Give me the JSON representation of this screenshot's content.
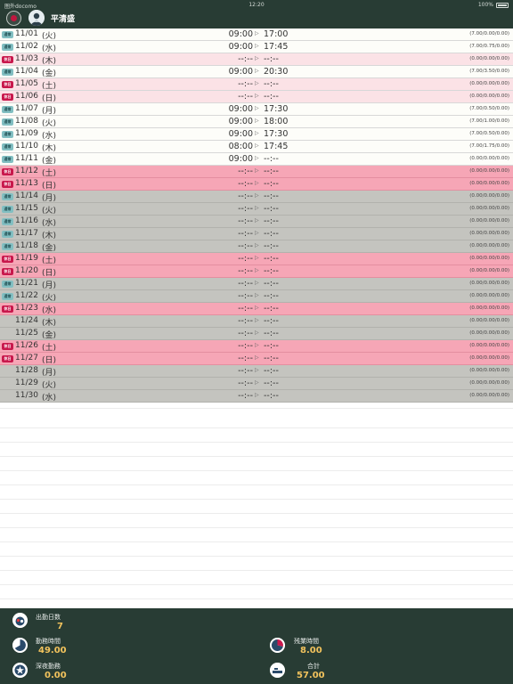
{
  "status_bar": {
    "carrier": "圏外docomo",
    "time": "12:20",
    "battery": "100%"
  },
  "header": {
    "user_name": "平清盛"
  },
  "days": [
    {
      "badge": "通常",
      "date": "11/01",
      "dow": "(火)",
      "in": "09:00",
      "out": "17:00",
      "hours": "(7.00/0.00/0.00)",
      "bg": "white"
    },
    {
      "badge": "通常",
      "date": "11/02",
      "dow": "(水)",
      "in": "09:00",
      "out": "17:45",
      "hours": "(7.00/0.75/0.00)",
      "bg": "white"
    },
    {
      "badge": "休日",
      "date": "11/03",
      "dow": "(木)",
      "in": "--:--",
      "out": "--:--",
      "hours": "(0.00/0.00/0.00)",
      "bg": "pink"
    },
    {
      "badge": "通常",
      "date": "11/04",
      "dow": "(金)",
      "in": "09:00",
      "out": "20:30",
      "hours": "(7.00/3.50/0.00)",
      "bg": "white"
    },
    {
      "badge": "休日",
      "date": "11/05",
      "dow": "(土)",
      "in": "--:--",
      "out": "--:--",
      "hours": "(0.00/0.00/0.00)",
      "bg": "pink"
    },
    {
      "badge": "休日",
      "date": "11/06",
      "dow": "(日)",
      "in": "--:--",
      "out": "--:--",
      "hours": "(0.00/0.00/0.00)",
      "bg": "pink"
    },
    {
      "badge": "通常",
      "date": "11/07",
      "dow": "(月)",
      "in": "09:00",
      "out": "17:30",
      "hours": "(7.00/0.50/0.00)",
      "bg": "white"
    },
    {
      "badge": "通常",
      "date": "11/08",
      "dow": "(火)",
      "in": "09:00",
      "out": "18:00",
      "hours": "(7.00/1.00/0.00)",
      "bg": "white"
    },
    {
      "badge": "通常",
      "date": "11/09",
      "dow": "(水)",
      "in": "09:00",
      "out": "17:30",
      "hours": "(7.00/0.50/0.00)",
      "bg": "white"
    },
    {
      "badge": "通常",
      "date": "11/10",
      "dow": "(木)",
      "in": "08:00",
      "out": "17:45",
      "hours": "(7.00/1.75/0.00)",
      "bg": "white"
    },
    {
      "badge": "通常",
      "date": "11/11",
      "dow": "(金)",
      "in": "09:00",
      "out": "--:--",
      "hours": "(0.00/0.00/0.00)",
      "bg": "white"
    },
    {
      "badge": "休日",
      "date": "11/12",
      "dow": "(土)",
      "in": "--:--",
      "out": "--:--",
      "hours": "(0.00/0.00/0.00)",
      "bg": "rose"
    },
    {
      "badge": "休日",
      "date": "11/13",
      "dow": "(日)",
      "in": "--:--",
      "out": "--:--",
      "hours": "(0.00/0.00/0.00)",
      "bg": "rose"
    },
    {
      "badge": "通常",
      "date": "11/14",
      "dow": "(月)",
      "in": "--:--",
      "out": "--:--",
      "hours": "(0.00/0.00/0.00)",
      "bg": "gray"
    },
    {
      "badge": "通常",
      "date": "11/15",
      "dow": "(火)",
      "in": "--:--",
      "out": "--:--",
      "hours": "(0.00/0.00/0.00)",
      "bg": "gray"
    },
    {
      "badge": "通常",
      "date": "11/16",
      "dow": "(水)",
      "in": "--:--",
      "out": "--:--",
      "hours": "(0.00/0.00/0.00)",
      "bg": "gray"
    },
    {
      "badge": "通常",
      "date": "11/17",
      "dow": "(木)",
      "in": "--:--",
      "out": "--:--",
      "hours": "(0.00/0.00/0.00)",
      "bg": "gray"
    },
    {
      "badge": "通常",
      "date": "11/18",
      "dow": "(金)",
      "in": "--:--",
      "out": "--:--",
      "hours": "(0.00/0.00/0.00)",
      "bg": "gray"
    },
    {
      "badge": "休日",
      "date": "11/19",
      "dow": "(土)",
      "in": "--:--",
      "out": "--:--",
      "hours": "(0.00/0.00/0.00)",
      "bg": "rose"
    },
    {
      "badge": "休日",
      "date": "11/20",
      "dow": "(日)",
      "in": "--:--",
      "out": "--:--",
      "hours": "(0.00/0.00/0.00)",
      "bg": "rose"
    },
    {
      "badge": "通常",
      "date": "11/21",
      "dow": "(月)",
      "in": "--:--",
      "out": "--:--",
      "hours": "(0.00/0.00/0.00)",
      "bg": "gray"
    },
    {
      "badge": "通常",
      "date": "11/22",
      "dow": "(火)",
      "in": "--:--",
      "out": "--:--",
      "hours": "(0.00/0.00/0.00)",
      "bg": "gray"
    },
    {
      "badge": "休日",
      "date": "11/23",
      "dow": "(水)",
      "in": "--:--",
      "out": "--:--",
      "hours": "(0.00/0.00/0.00)",
      "bg": "rose"
    },
    {
      "badge": "",
      "date": "11/24",
      "dow": "(木)",
      "in": "--:--",
      "out": "--:--",
      "hours": "(0.00/0.00/0.00)",
      "bg": "gray"
    },
    {
      "badge": "",
      "date": "11/25",
      "dow": "(金)",
      "in": "--:--",
      "out": "--:--",
      "hours": "(0.00/0.00/0.00)",
      "bg": "gray"
    },
    {
      "badge": "休日",
      "date": "11/26",
      "dow": "(土)",
      "in": "--:--",
      "out": "--:--",
      "hours": "(0.00/0.00/0.00)",
      "bg": "rose"
    },
    {
      "badge": "休日",
      "date": "11/27",
      "dow": "(日)",
      "in": "--:--",
      "out": "--:--",
      "hours": "(0.00/0.00/0.00)",
      "bg": "rose"
    },
    {
      "badge": "",
      "date": "11/28",
      "dow": "(月)",
      "in": "--:--",
      "out": "--:--",
      "hours": "(0.00/0.00/0.00)",
      "bg": "gray"
    },
    {
      "badge": "",
      "date": "11/29",
      "dow": "(火)",
      "in": "--:--",
      "out": "--:--",
      "hours": "(0.00/0.00/0.00)",
      "bg": "gray"
    },
    {
      "badge": "",
      "date": "11/30",
      "dow": "(水)",
      "in": "--:--",
      "out": "--:--",
      "hours": "(0.00/0.00/0.00)",
      "bg": "gray"
    }
  ],
  "arrow_glyph": "▷",
  "summary": {
    "attendance_days_label": "出勤日数",
    "attendance_days_value": "7",
    "work_hours_label": "勤務時間",
    "work_hours_value": "49.00",
    "night_work_label": "深夜勤務",
    "night_work_value": "0.00",
    "overtime_label": "残業時間",
    "overtime_value": "8.00",
    "total_label": "合計",
    "total_value": "57.00"
  },
  "colors": {
    "header_bg": "#283c34",
    "row_white": "#fdfdf9",
    "row_pink": "#fbe2e6",
    "row_rose": "#f6a6b6",
    "row_gray": "#c4c4bf",
    "badge_normal": "#82bfc2",
    "badge_holiday": "#c8184c",
    "summary_value": "#f2c35d"
  }
}
